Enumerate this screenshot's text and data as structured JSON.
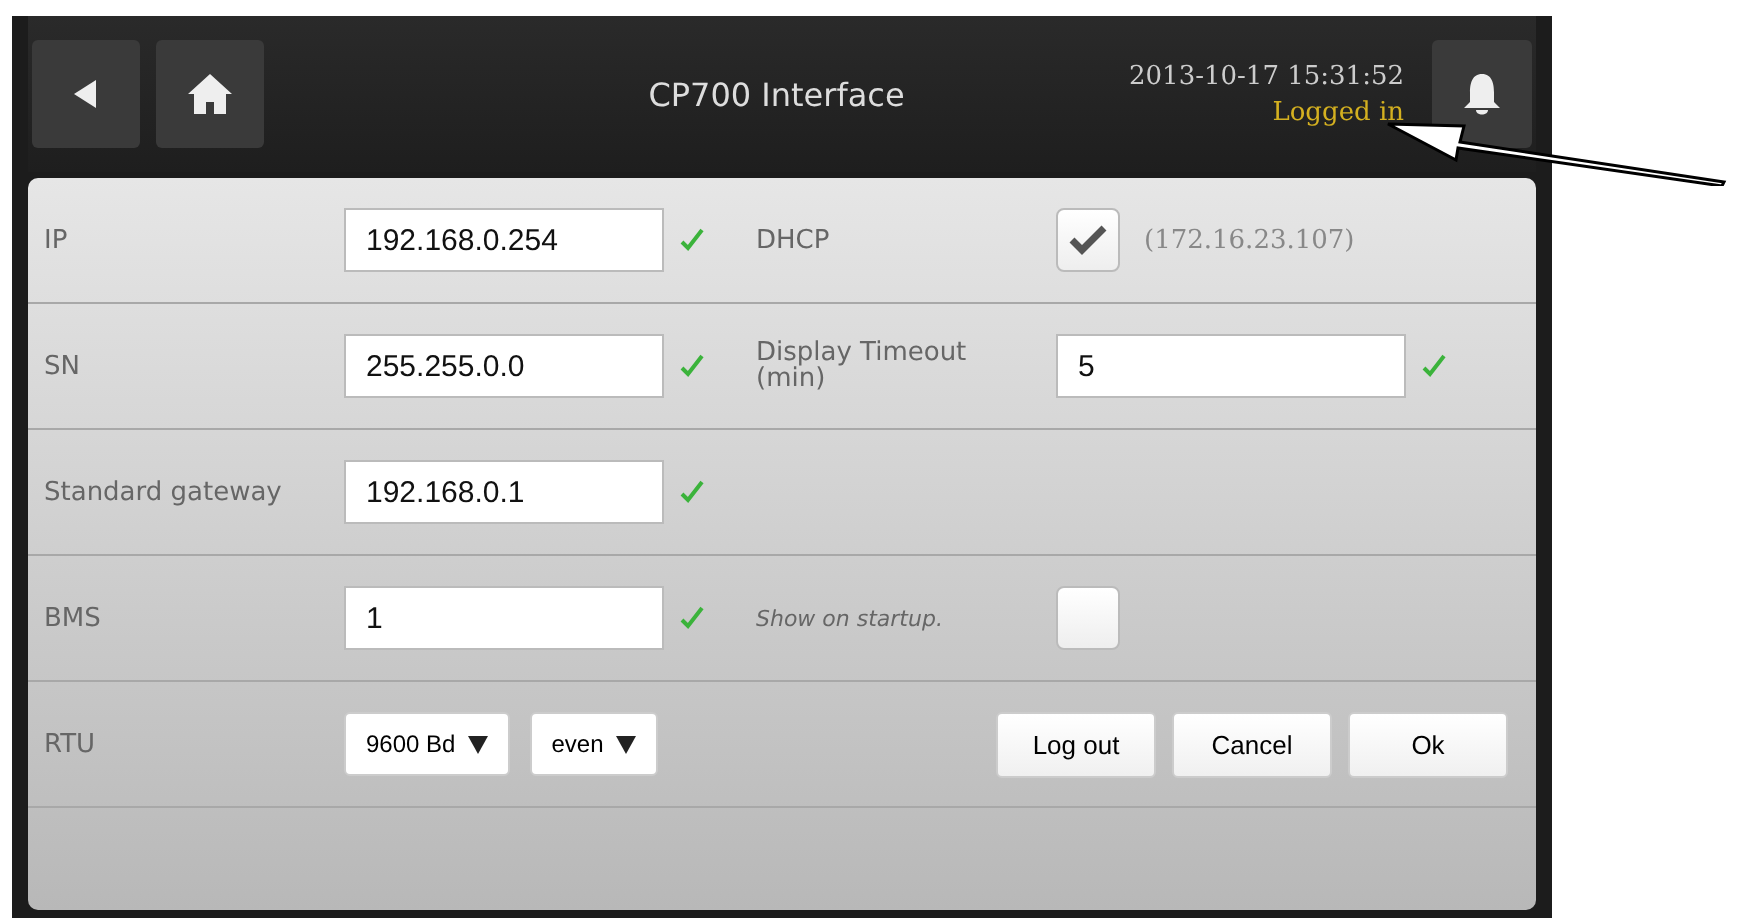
{
  "header": {
    "title": "CP700 Interface",
    "datetime": "2013-10-17 15:31:52",
    "status": "Logged in"
  },
  "rows": [
    {
      "label": "IP",
      "field": {
        "value": "192.168.0.254",
        "valid": true
      },
      "right": {
        "kind": "checkbox",
        "label": "DHCP",
        "checked": true,
        "note": "(172.16.23.107)"
      }
    },
    {
      "label": "SN",
      "field": {
        "value": "255.255.0.0",
        "valid": true
      },
      "right": {
        "kind": "field",
        "label": "Display Timeout (min)",
        "value": "5",
        "valid": true
      }
    },
    {
      "label": "Standard gateway",
      "field": {
        "value": "192.168.0.1",
        "valid": true
      }
    },
    {
      "label": "BMS",
      "field": {
        "value": "1",
        "valid": true
      },
      "right": {
        "kind": "checkbox",
        "label": "Show on startup.",
        "italic": true,
        "checked": false
      }
    },
    {
      "label": "RTU",
      "selects": [
        "9600 Bd",
        "even"
      ],
      "buttons": [
        "Log out",
        "Cancel",
        "Ok"
      ]
    }
  ]
}
